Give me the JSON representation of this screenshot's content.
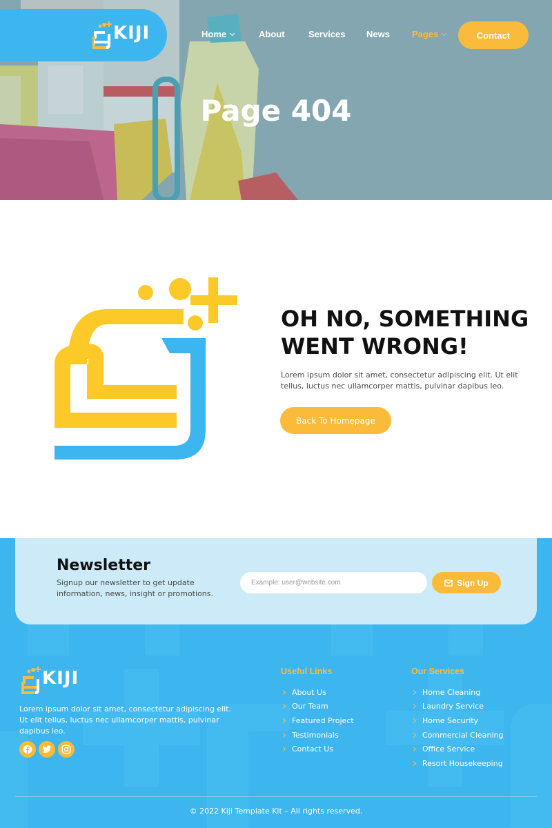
{
  "brand": {
    "name": "KIJI"
  },
  "nav": {
    "items": [
      {
        "label": "Home",
        "has_dropdown": true,
        "active": false
      },
      {
        "label": "About",
        "has_dropdown": false,
        "active": false
      },
      {
        "label": "Services",
        "has_dropdown": false,
        "active": false
      },
      {
        "label": "News",
        "has_dropdown": false,
        "active": false
      },
      {
        "label": "Pages",
        "has_dropdown": true,
        "active": true
      }
    ],
    "contact_label": "Contact"
  },
  "hero": {
    "title": "Page 404"
  },
  "error": {
    "title_line1": "OH NO, SOMETHING",
    "title_line2": "WENT WRONG!",
    "text": "Lorem ipsum dolor sit amet, consectetur adipiscing elit. Ut elit tellus, luctus nec ullamcorper mattis, pulvinar dapibus leo.",
    "button_label": "Back To Homepage"
  },
  "newsletter": {
    "title": "Newsletter",
    "text": "Signup our newsletter to get update information, news, insight or promotions.",
    "input_placeholder": "Example: user@website.com",
    "button_label": "Sign Up",
    "button_icon": "envelope-icon"
  },
  "footer": {
    "about": "Lorem ipsum dolor sit amet, consectetur adipiscing elit. Ut elit tellus, luctus nec ullamcorper mattis, pulvinar dapibus leo.",
    "socials": [
      "facebook-icon",
      "twitter-icon",
      "instagram-icon"
    ],
    "useful_links": {
      "title": "Useful Links",
      "items": [
        "About Us",
        "Our Team",
        "Featured Project",
        "Testimonials",
        "Contact Us"
      ]
    },
    "our_services": {
      "title": "Our Services",
      "items": [
        "Home Cleaning",
        "Laundry Service",
        "Home Security",
        "Commercial Cleaning",
        "Office Service",
        "Resort Housekeeping"
      ]
    },
    "copyright": "© 2022 Kiji Template Kit – All rights reserved."
  },
  "colors": {
    "primary_blue": "#3db5ee",
    "accent_yellow": "#fbbb3a",
    "light_blue": "#cdeaf8"
  }
}
